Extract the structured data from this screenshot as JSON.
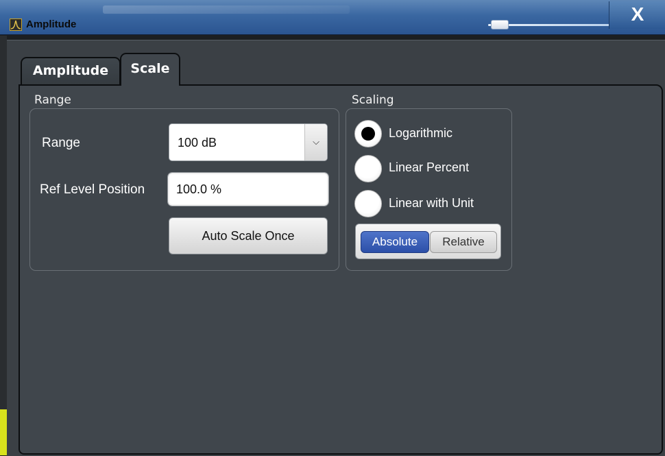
{
  "window": {
    "title": "Amplitude",
    "close_label": "X",
    "app_icon": "spectrum-analyzer-icon"
  },
  "tabs": [
    {
      "label": "Amplitude",
      "active": false
    },
    {
      "label": "Scale",
      "active": true
    }
  ],
  "range_group": {
    "title": "Range",
    "range_label": "Range",
    "range_value": "100 dB",
    "ref_level_label": "Ref Level Position",
    "ref_level_value": "100.0 %",
    "auto_scale_button": "Auto Scale Once"
  },
  "scaling_group": {
    "title": "Scaling",
    "options": [
      {
        "label": "Logarithmic",
        "selected": true
      },
      {
        "label": "Linear Percent",
        "selected": false
      },
      {
        "label": "Linear with Unit",
        "selected": false
      }
    ],
    "mode_toggle": [
      {
        "label": "Absolute",
        "selected": true
      },
      {
        "label": "Relative",
        "selected": false
      }
    ]
  },
  "colors": {
    "titlebar": "#3a67a1",
    "dialog_bg": "#40464c",
    "accent": "#2c4fa8"
  }
}
